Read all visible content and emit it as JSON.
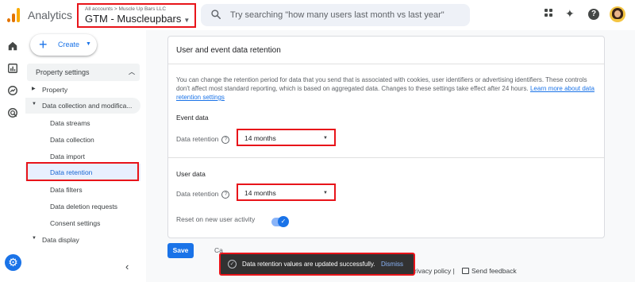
{
  "app": {
    "title": "Analytics"
  },
  "account": {
    "breadcrumb": "All accounts > Muscle Up Bars LLC",
    "property": "GTM - Muscleupbars"
  },
  "search": {
    "placeholder": "Try searching \"how many users last month vs last year\""
  },
  "create_button": {
    "label": "Create"
  },
  "nav": {
    "header": "Property settings",
    "items": [
      {
        "label": "Property",
        "kind": "group",
        "expanded": false
      },
      {
        "label": "Data collection and modifica...",
        "kind": "group",
        "expanded": true
      },
      {
        "label": "Data streams",
        "kind": "sub"
      },
      {
        "label": "Data collection",
        "kind": "sub"
      },
      {
        "label": "Data import",
        "kind": "sub"
      },
      {
        "label": "Data retention",
        "kind": "sub",
        "active": true
      },
      {
        "label": "Data filters",
        "kind": "sub"
      },
      {
        "label": "Data deletion requests",
        "kind": "sub"
      },
      {
        "label": "Consent settings",
        "kind": "sub"
      },
      {
        "label": "Data display",
        "kind": "group",
        "expanded": false
      }
    ]
  },
  "card": {
    "title": "User and event data retention",
    "description": "You can change the retention period for data that you send that is associated with cookies, user identifiers or advertising identifiers. These controls don't affect most standard reporting, which is based on aggregated data. Changes to these settings take effect after 24 hours.",
    "learn_more": "Learn more about data retention settings",
    "event_data": {
      "title": "Event data",
      "label": "Data retention",
      "value": "14 months"
    },
    "user_data": {
      "title": "User data",
      "label": "Data retention",
      "value": "14 months"
    },
    "reset_label": "Reset on new user activity",
    "reset_enabled": true
  },
  "actions": {
    "save": "Save",
    "cancel": "Ca"
  },
  "footer": {
    "privacy": "rivacy policy",
    "separator": "|",
    "feedback": "Send feedback"
  },
  "snackbar": {
    "message": "Data retention values are updated successfully.",
    "dismiss": "Dismiss"
  },
  "colors": {
    "accent": "#1a73e8",
    "highlight": "#e8141a",
    "snackbar": "#323232"
  }
}
